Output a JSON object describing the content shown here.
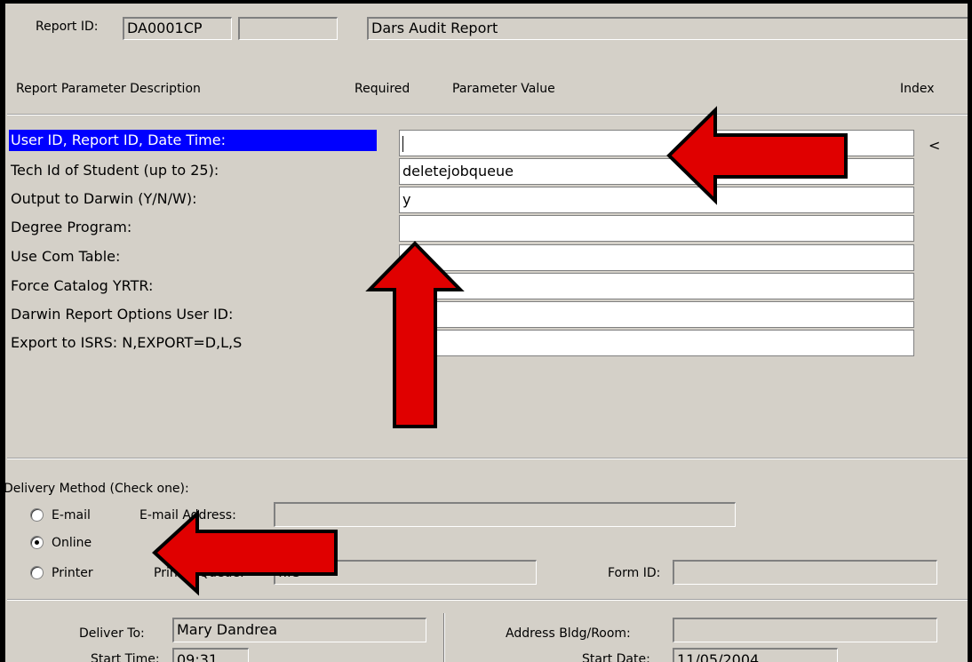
{
  "header": {
    "report_id_label": "Report ID:",
    "report_id_value": "DA0001CP",
    "report_id_extra": "",
    "report_title": "Dars Audit Report"
  },
  "columns": {
    "description": "Report Parameter Description",
    "required": "Required",
    "value": "Parameter Value",
    "index": "Index"
  },
  "parameters": [
    {
      "label": "User ID, Report ID, Date Time:",
      "value": "",
      "selected": true
    },
    {
      "label": "Tech Id of Student (up to 25):",
      "value": "deletejobqueue"
    },
    {
      "label": "Output to Darwin (Y/N/W):",
      "value": "y"
    },
    {
      "label": "Degree Program:",
      "value": ""
    },
    {
      "label": "Use Com Table:",
      "value": ""
    },
    {
      "label": "Force Catalog YRTR:",
      "value": ""
    },
    {
      "label": "Darwin Report Options User ID:",
      "value": ""
    },
    {
      "label": "Export to ISRS: N,EXPORT=D,L,S",
      "value": ""
    }
  ],
  "index_marker": "<",
  "delivery": {
    "title": "Delivery Method (Check one):",
    "options": [
      {
        "label": "E-mail",
        "selected": false
      },
      {
        "label": "Online",
        "selected": true
      },
      {
        "label": "Printer",
        "selected": false
      }
    ],
    "email_label": "E-mail Address:",
    "email_value": "",
    "printer_queue_label": "Printer Queue:",
    "printer_queue_value": "file",
    "form_id_label": "Form ID:",
    "form_id_value": ""
  },
  "footer": {
    "deliver_to_label": "Deliver To:",
    "deliver_to_value": "Mary Dandrea",
    "address_label": "Address Bldg/Room:",
    "address_value": "",
    "start_time_label": "Start Time:",
    "start_time_value": "09:31",
    "start_date_label": "Start Date:",
    "start_date_value": "11/05/2004"
  },
  "colors": {
    "window_bg": "#d4d0c8",
    "selection": "#0000ff",
    "arrow_fill": "#e00000"
  }
}
